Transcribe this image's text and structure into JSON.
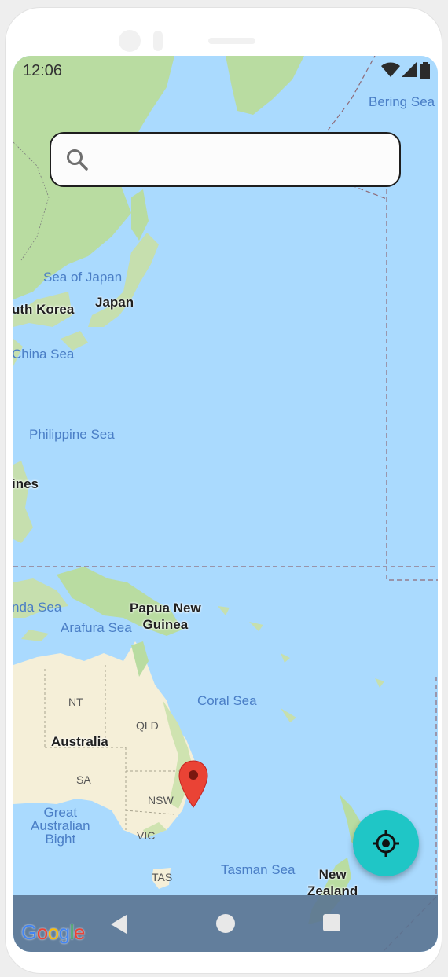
{
  "status_bar": {
    "time": "12:06"
  },
  "search": {
    "value": "",
    "placeholder": ""
  },
  "map": {
    "labels": {
      "bering_sea": "Bering Sea",
      "sea_of_japan": "Sea of Japan",
      "japan": "Japan",
      "south_korea": "uth Korea",
      "china_sea": "China Sea",
      "philippine_sea": "Philippine Sea",
      "philippines": "ines",
      "banda_sea": "nda Sea",
      "papua_new_guinea": "Papua New\nGuinea",
      "arafura_sea": "Arafura Sea",
      "coral_sea": "Coral Sea",
      "nt": "NT",
      "qld": "QLD",
      "australia": "Australia",
      "sa": "SA",
      "nsw": "NSW",
      "great_australian_bight": "Great\nAustralian\nBight",
      "vic": "VIC",
      "tas": "TAS",
      "tasman_sea": "Tasman Sea",
      "new_zealand": "New\nZealand"
    }
  },
  "branding": {
    "google": [
      "G",
      "o",
      "o",
      "g",
      "l",
      "e"
    ]
  },
  "colors": {
    "water": "#aadafe",
    "land": "#f5efd8",
    "vegetation": "#b9dca1",
    "marker": "#ea4335",
    "fab": "#1fc6c6",
    "nav_bar": "#5a7391"
  },
  "icons": {
    "search": "search-icon",
    "marker": "map-marker-icon",
    "my_location": "my-location-icon",
    "back": "back-triangle-icon",
    "home": "home-circle-icon",
    "recents": "recents-square-icon"
  }
}
